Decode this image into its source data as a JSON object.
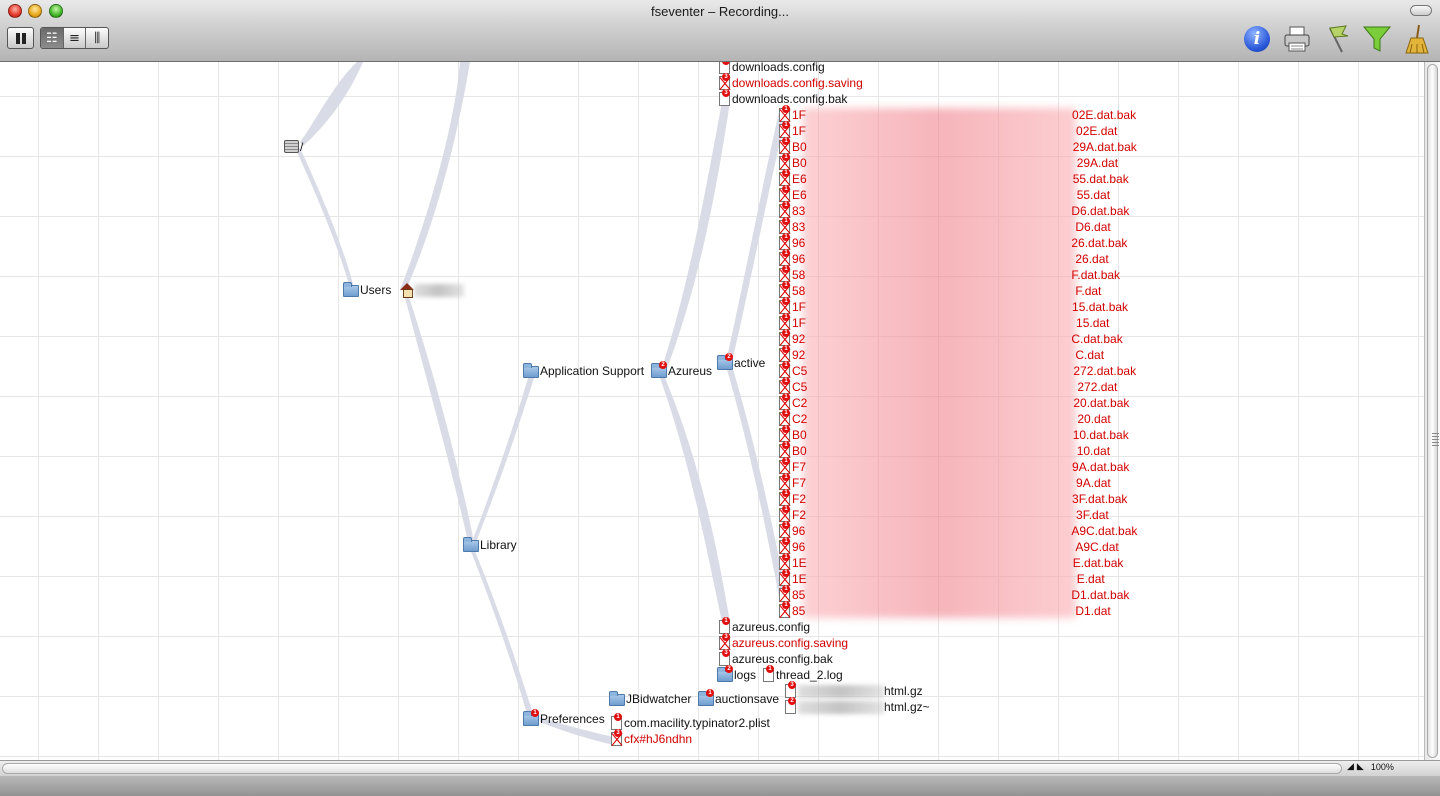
{
  "window": {
    "title": "fseventer – Recording..."
  },
  "toolbar": {
    "pause_icon": "pause-icon",
    "view_modes": [
      "tree-view-icon",
      "list-view-icon",
      "column-view-icon"
    ],
    "right_icons": [
      "info-icon",
      "print-icon",
      "flag-filter-icon",
      "funnel-filter-icon",
      "broom-clear-icon"
    ]
  },
  "colors": {
    "deleted_text": "#d20000",
    "branch": "#d9dbe6"
  },
  "tree": {
    "root": "/",
    "users": "Users",
    "library": "Library",
    "application_support": "Application Support",
    "azureus": "Azureus",
    "active": "active",
    "preferences": "Preferences",
    "jbidwatcher": "JBidwatcher",
    "auctionsave": "auctionsave",
    "logs": "logs",
    "thread_log": "thread_2.log",
    "plist": "com.macility.typinator2.plist",
    "cfx": "cfx#hJ6ndhn",
    "html_gz": "html.gz",
    "html_gz_tilde": "html.gz~",
    "top_files": [
      {
        "name": "downloads.config",
        "deleted": false
      },
      {
        "name": "downloads.config.saving",
        "deleted": true
      },
      {
        "name": "downloads.config.bak",
        "deleted": false
      }
    ],
    "config_files": [
      {
        "name": "azureus.config",
        "deleted": false
      },
      {
        "name": "azureus.config.saving",
        "deleted": true
      },
      {
        "name": "azureus.config.bak",
        "deleted": false
      }
    ],
    "dat_files": [
      {
        "p": "1F",
        "s": "02E.dat.bak"
      },
      {
        "p": "1F",
        "s": "02E.dat"
      },
      {
        "p": "B0",
        "s": "29A.dat.bak"
      },
      {
        "p": "B0",
        "s": "29A.dat"
      },
      {
        "p": "E6",
        "s": "55.dat.bak"
      },
      {
        "p": "E6",
        "s": "55.dat"
      },
      {
        "p": "83",
        "s": "D6.dat.bak"
      },
      {
        "p": "83",
        "s": "D6.dat"
      },
      {
        "p": "96",
        "s": "26.dat.bak"
      },
      {
        "p": "96",
        "s": "26.dat"
      },
      {
        "p": "58",
        "s": "F.dat.bak"
      },
      {
        "p": "58",
        "s": "F.dat"
      },
      {
        "p": "1F",
        "s": "15.dat.bak"
      },
      {
        "p": "1F",
        "s": "15.dat"
      },
      {
        "p": "92",
        "s": "C.dat.bak"
      },
      {
        "p": "92",
        "s": "C.dat"
      },
      {
        "p": "C5",
        "s": "272.dat.bak"
      },
      {
        "p": "C5",
        "s": "272.dat"
      },
      {
        "p": "C2",
        "s": "20.dat.bak"
      },
      {
        "p": "C2",
        "s": "20.dat"
      },
      {
        "p": "B0",
        "s": "10.dat.bak"
      },
      {
        "p": "B0",
        "s": "10.dat"
      },
      {
        "p": "F7",
        "s": "9A.dat.bak"
      },
      {
        "p": "F7",
        "s": "9A.dat"
      },
      {
        "p": "F2",
        "s": "3F.dat.bak"
      },
      {
        "p": "F2",
        "s": "3F.dat"
      },
      {
        "p": "96",
        "s": "A9C.dat.bak"
      },
      {
        "p": "96",
        "s": "A9C.dat"
      },
      {
        "p": "1E",
        "s": "E.dat.bak"
      },
      {
        "p": "1E",
        "s": "E.dat"
      },
      {
        "p": "85",
        "s": "D1.dat.bak"
      },
      {
        "p": "85",
        "s": "D1.dat"
      }
    ]
  },
  "status": {
    "zoom": "100%"
  }
}
